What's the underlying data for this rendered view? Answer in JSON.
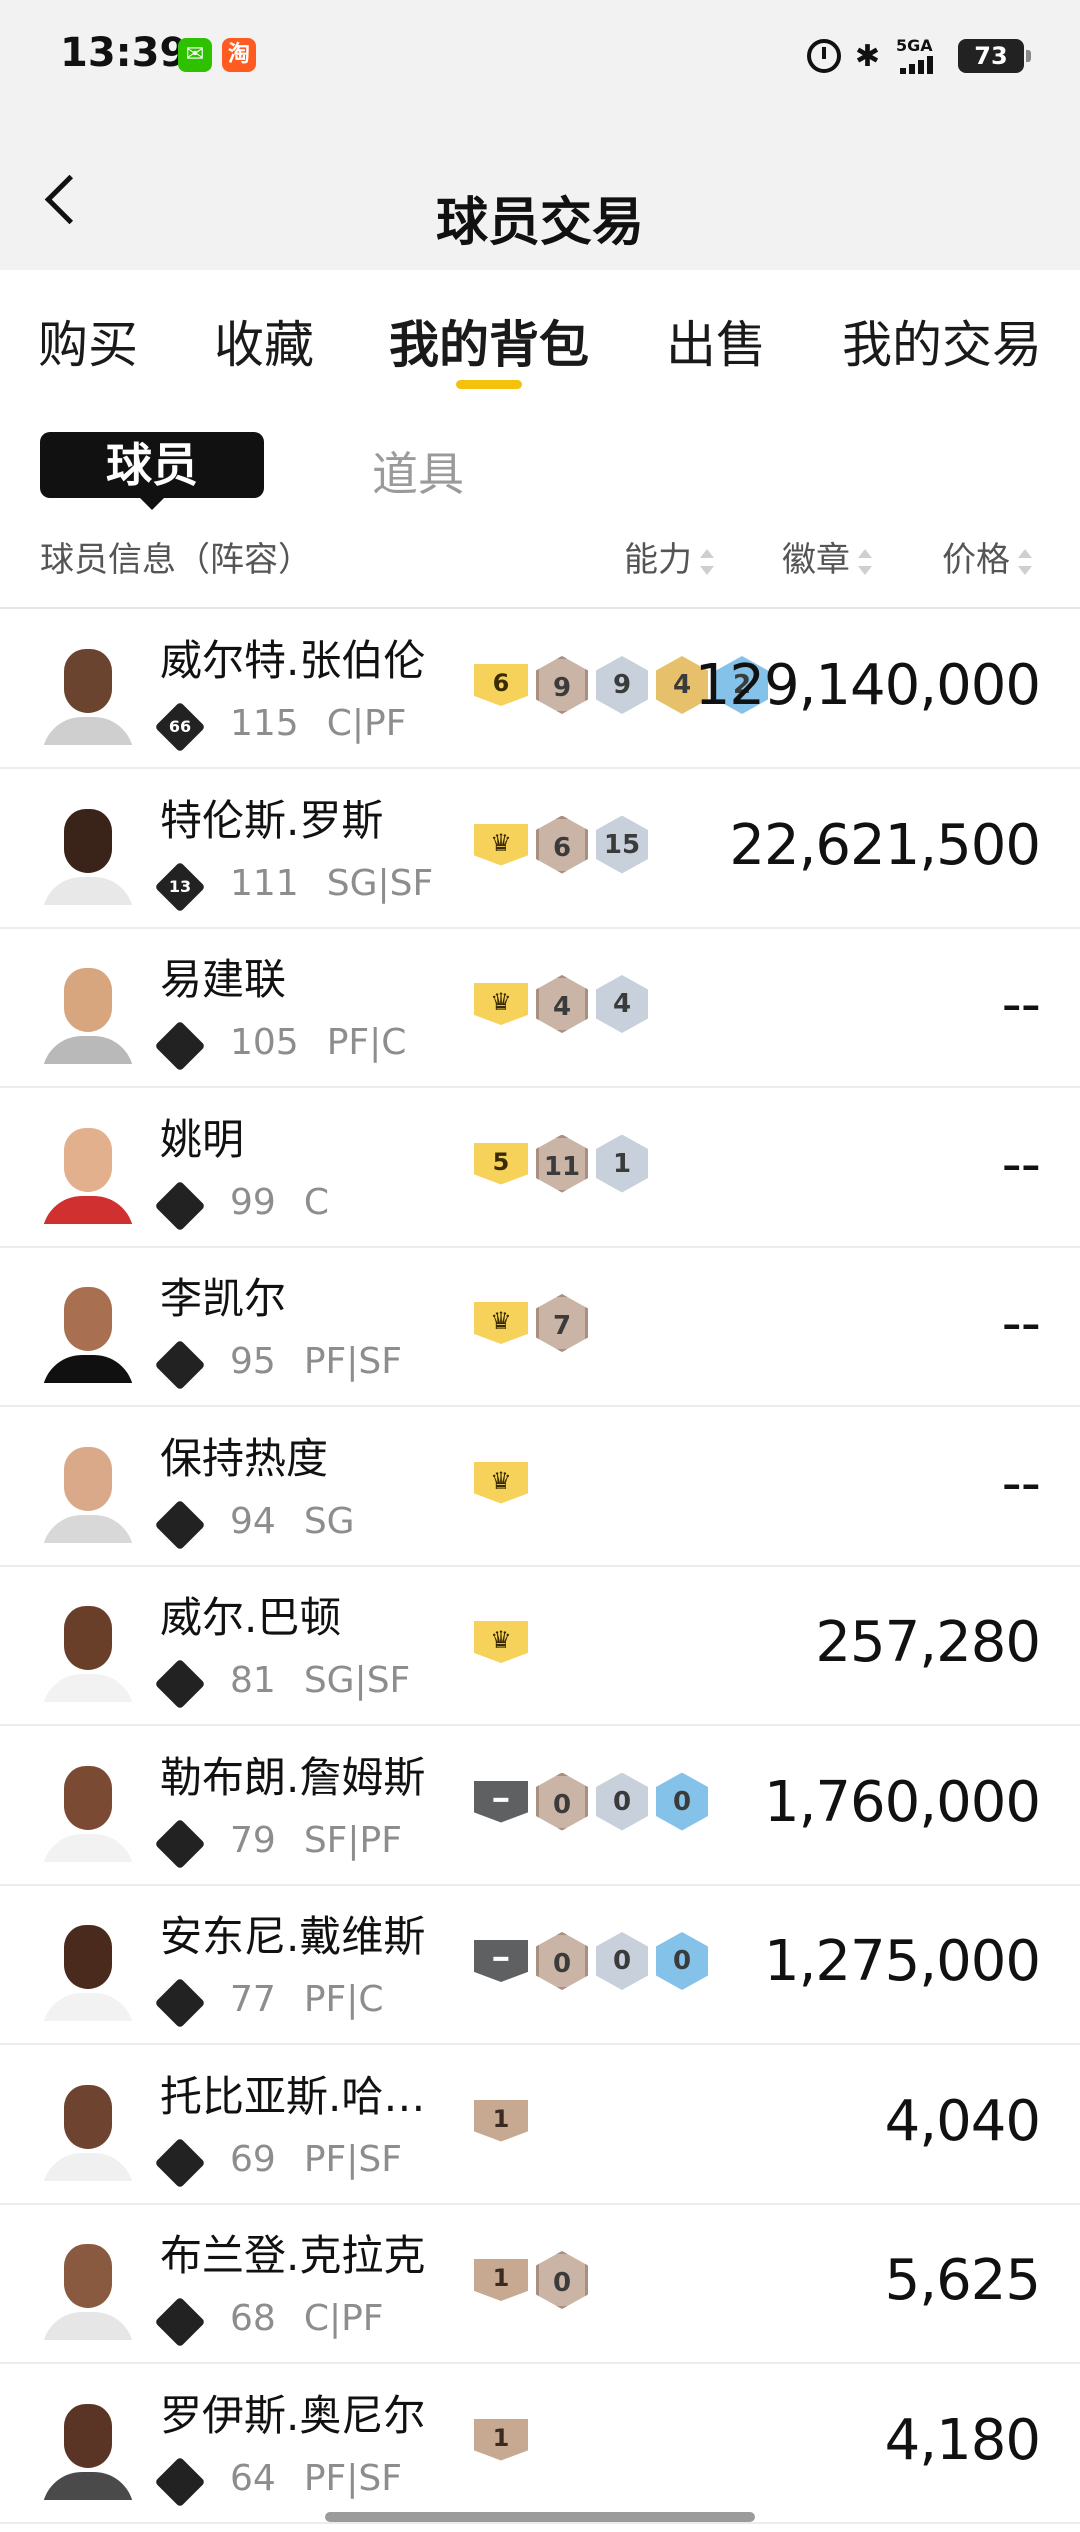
{
  "status": {
    "time": "13:39",
    "network": "5GA",
    "battery": "73"
  },
  "header": {
    "title": "球员交易"
  },
  "tabs": [
    {
      "label": "购买"
    },
    {
      "label": "收藏"
    },
    {
      "label": "我的背包"
    },
    {
      "label": "出售"
    },
    {
      "label": "我的交易"
    }
  ],
  "segments": {
    "player": "球员",
    "item": "道具"
  },
  "columns": {
    "info": "球员信息（阵容）",
    "ability": "能力",
    "badge": "徽章",
    "price": "价格"
  },
  "players": [
    {
      "name": "威尔特.张伯伦",
      "tier": "66",
      "ovr": "115",
      "pos": "C|PF",
      "rank": "6",
      "rank_style": "gold",
      "badges": [
        {
          "v": "9",
          "c": "b"
        },
        {
          "v": "9",
          "c": "s"
        },
        {
          "v": "4",
          "c": "g"
        },
        {
          "v": "2",
          "c": "blue"
        }
      ],
      "price": "129,140,000"
    },
    {
      "name": "特伦斯.罗斯",
      "tier": "13",
      "ovr": "111",
      "pos": "SG|SF",
      "rank": "♛",
      "rank_style": "crown",
      "badges": [
        {
          "v": "6",
          "c": "b"
        },
        {
          "v": "15",
          "c": "s"
        }
      ],
      "price": "22,621,500"
    },
    {
      "name": "易建联",
      "tier": "",
      "ovr": "105",
      "pos": "PF|C",
      "rank": "♛",
      "rank_style": "crown",
      "badges": [
        {
          "v": "4",
          "c": "b"
        },
        {
          "v": "4",
          "c": "s"
        }
      ],
      "price": "--"
    },
    {
      "name": "姚明",
      "tier": "",
      "ovr": "99",
      "pos": "C",
      "rank": "5",
      "rank_style": "gold",
      "badges": [
        {
          "v": "11",
          "c": "b"
        },
        {
          "v": "1",
          "c": "s"
        }
      ],
      "price": "--"
    },
    {
      "name": "李凯尔",
      "tier": "",
      "ovr": "95",
      "pos": "PF|SF",
      "rank": "♛",
      "rank_style": "crown",
      "badges": [
        {
          "v": "7",
          "c": "b"
        }
      ],
      "price": "--"
    },
    {
      "name": "保持热度",
      "tier": "",
      "ovr": "94",
      "pos": "SG",
      "rank": "♛",
      "rank_style": "crown",
      "badges": [],
      "price": "--"
    },
    {
      "name": "威尔.巴顿",
      "tier": "",
      "ovr": "81",
      "pos": "SG|SF",
      "rank": "♛",
      "rank_style": "crown",
      "badges": [],
      "price": "257,280"
    },
    {
      "name": "勒布朗.詹姆斯",
      "tier": "",
      "ovr": "79",
      "pos": "SF|PF",
      "rank": "━",
      "rank_style": "dark",
      "badges": [
        {
          "v": "0",
          "c": "b"
        },
        {
          "v": "0",
          "c": "s"
        },
        {
          "v": "0",
          "c": "blue"
        }
      ],
      "price": "1,760,000"
    },
    {
      "name": "安东尼.戴维斯",
      "tier": "",
      "ovr": "77",
      "pos": "PF|C",
      "rank": "━",
      "rank_style": "dark",
      "badges": [
        {
          "v": "0",
          "c": "b"
        },
        {
          "v": "0",
          "c": "s"
        },
        {
          "v": "0",
          "c": "blue"
        }
      ],
      "price": "1,275,000"
    },
    {
      "name": "托比亚斯.哈…",
      "tier": "",
      "ovr": "69",
      "pos": "PF|SF",
      "rank": "1",
      "rank_style": "bronze",
      "badges": [],
      "price": "4,040"
    },
    {
      "name": "布兰登.克拉克",
      "tier": "",
      "ovr": "68",
      "pos": "C|PF",
      "rank": "1",
      "rank_style": "bronze",
      "badges": [
        {
          "v": "0",
          "c": "b"
        }
      ],
      "price": "5,625"
    },
    {
      "name": "罗伊斯.奥尼尔",
      "tier": "",
      "ovr": "64",
      "pos": "PF|SF",
      "rank": "1",
      "rank_style": "bronze",
      "badges": [],
      "price": "4,180"
    }
  ],
  "colors": {
    "accent": "#f4c20d",
    "segment_bg": "#111111",
    "header_bg": "#f2f2f2"
  }
}
